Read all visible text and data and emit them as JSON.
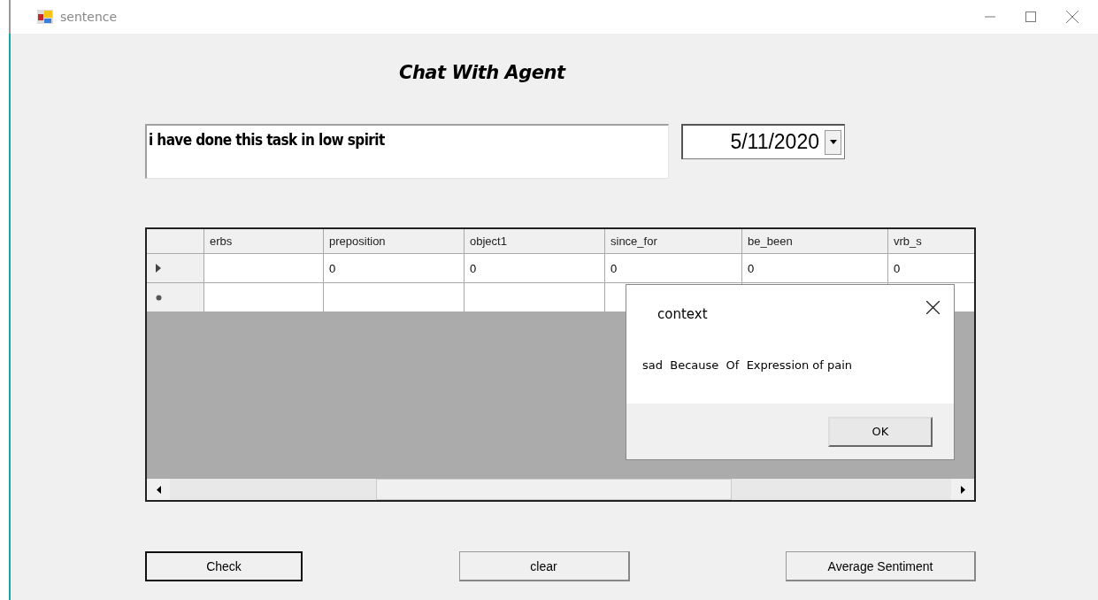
{
  "window": {
    "title": "sentence"
  },
  "heading": "Chat With Agent",
  "message": {
    "value": "i have done this task in low spirit"
  },
  "date_picker": {
    "value": "5/11/2020"
  },
  "grid": {
    "columns": [
      "erbs",
      "preposition",
      "object1",
      "since_for",
      "be_been",
      "vrb_s"
    ],
    "rows": [
      {
        "kind": "current",
        "cells": [
          null,
          "0",
          "0",
          "0",
          "0",
          "0"
        ]
      },
      {
        "kind": "new"
      }
    ]
  },
  "dialog": {
    "title": "context",
    "message": "sad  Because  Of  Expression of pain",
    "button": "OK"
  },
  "buttons": [
    {
      "label": "Check",
      "focused": true
    },
    {
      "label": "clear",
      "focused": false
    },
    {
      "label": "Average Sentiment",
      "focused": false
    }
  ]
}
